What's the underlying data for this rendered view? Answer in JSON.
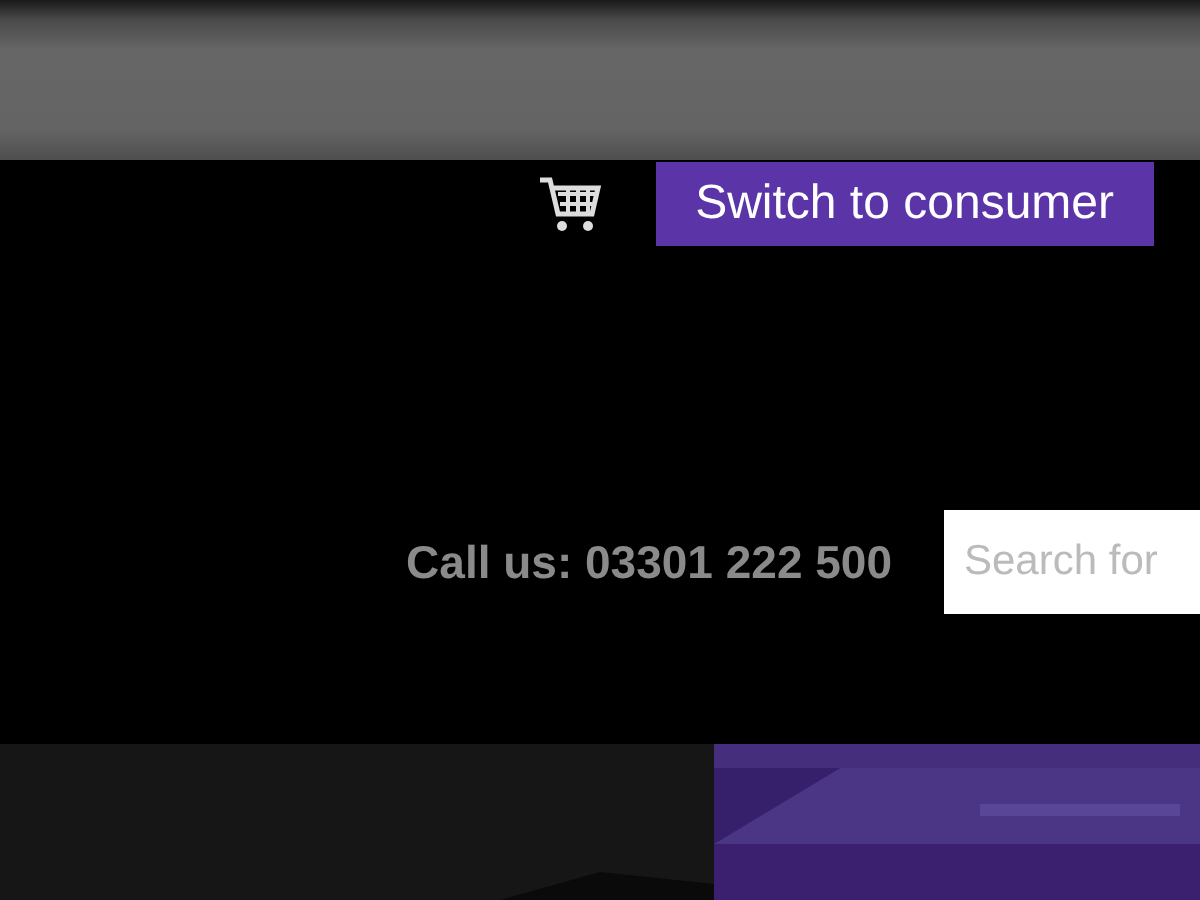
{
  "header": {
    "cart": {
      "kind": "cart"
    },
    "switch_button": "Switch to consumer"
  },
  "contact": {
    "phone_text": "Call us: 03301 222 500"
  },
  "search": {
    "placeholder": "Search for"
  }
}
